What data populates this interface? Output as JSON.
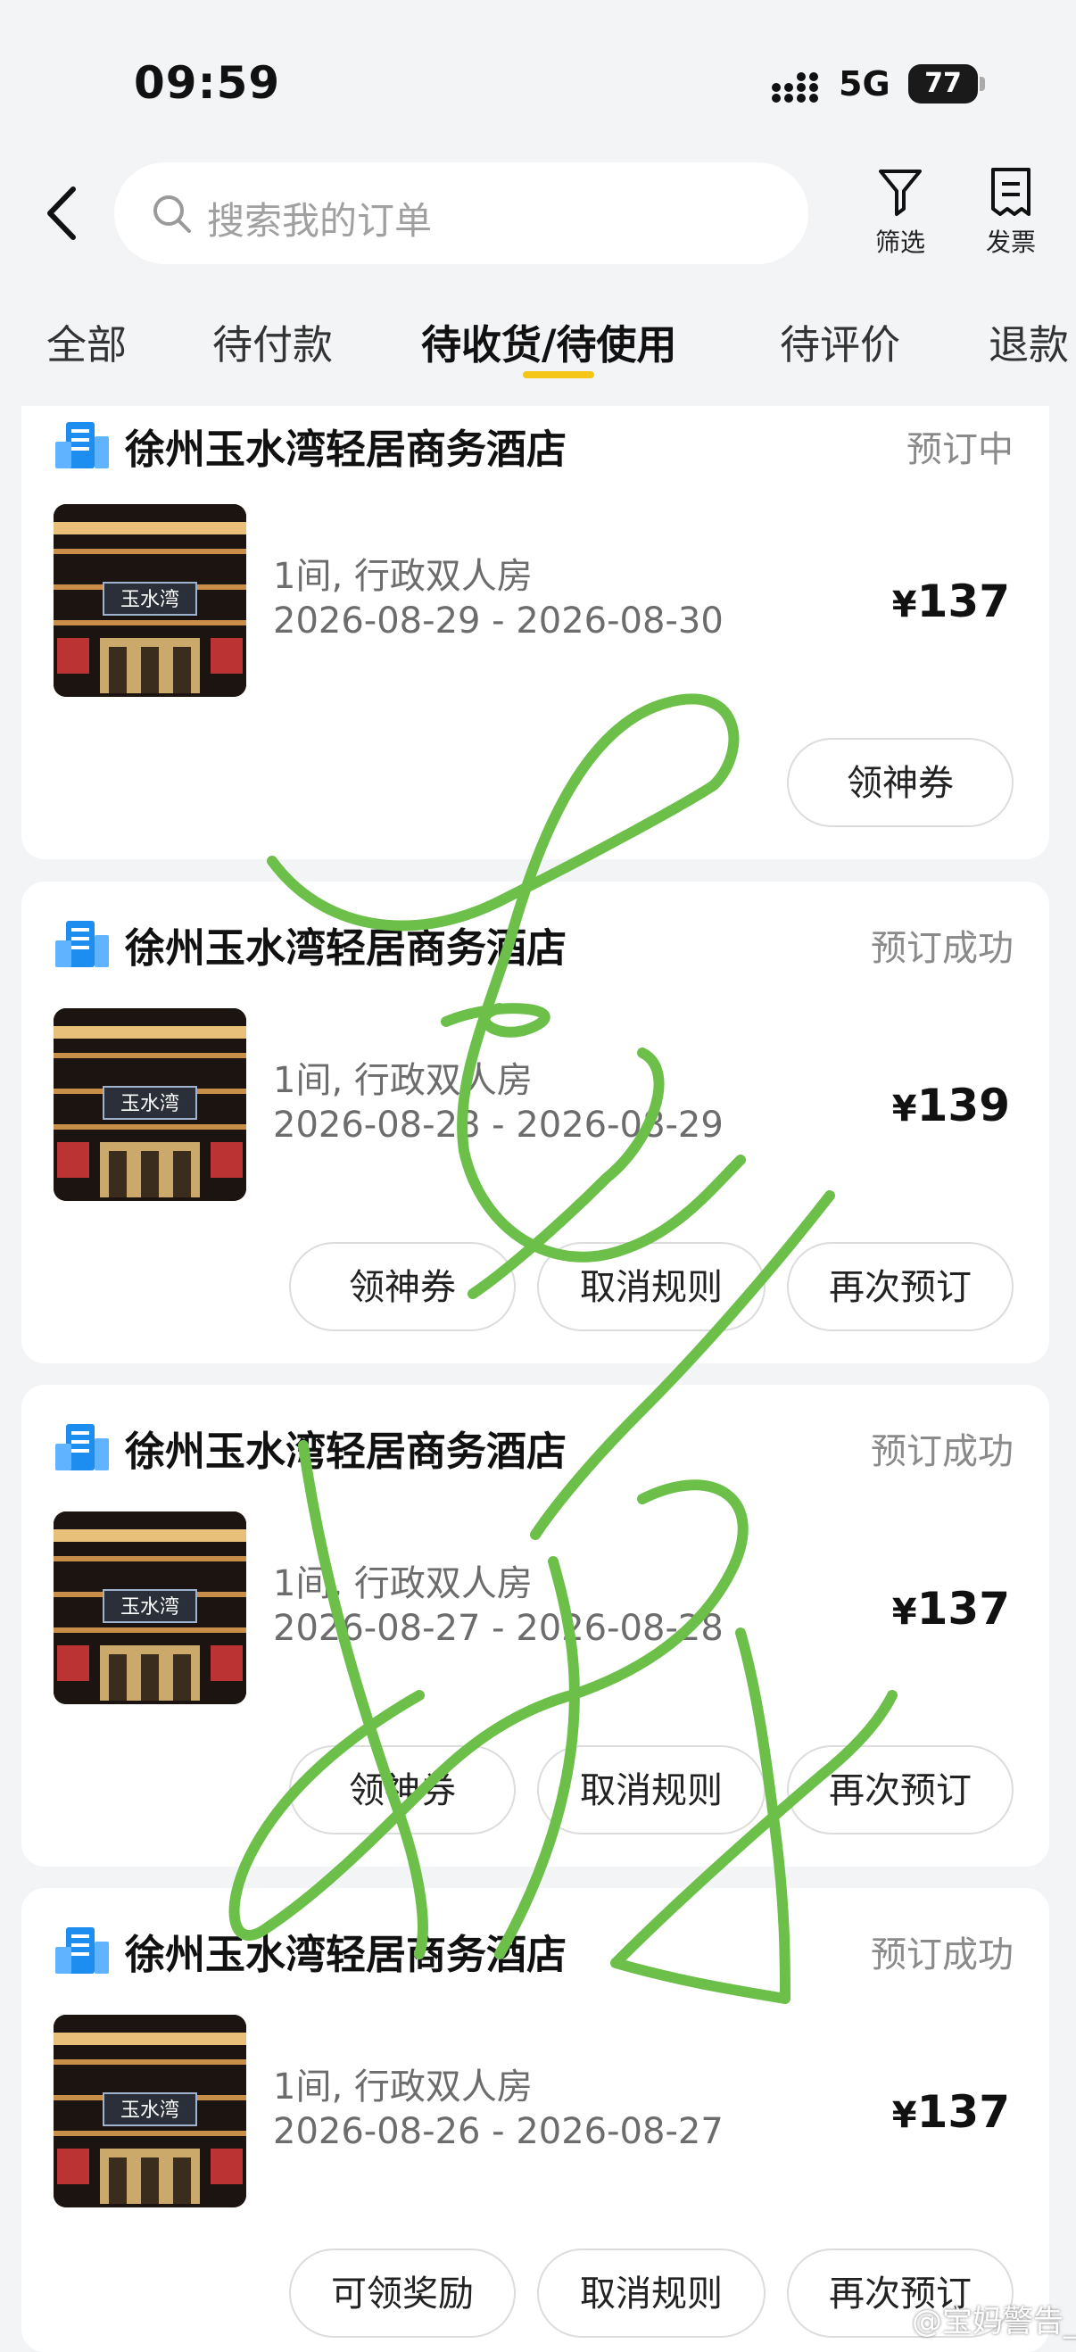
{
  "status_bar": {
    "time": "09:59",
    "network": "5G",
    "battery": "77"
  },
  "header": {
    "search_placeholder": "搜索我的订单",
    "filter_label": "筛选",
    "invoice_label": "发票"
  },
  "tabs": [
    {
      "label": "全部"
    },
    {
      "label": "待付款"
    },
    {
      "label": "待收货/待使用",
      "active": true
    },
    {
      "label": "待评价"
    },
    {
      "label": "退款"
    }
  ],
  "orders": [
    {
      "hotel": "徐州玉水湾轻居商务酒店",
      "status": "预订中",
      "room": "1间, 行政双人房",
      "dates": "2026-08-29 - 2026-08-30",
      "currency": "¥",
      "price": "137",
      "buttons": [
        "领神券"
      ]
    },
    {
      "hotel": "徐州玉水湾轻居商务酒店",
      "status": "预订成功",
      "room": "1间, 行政双人房",
      "dates": "2026-08-28 - 2026-08-29",
      "currency": "¥",
      "price": "139",
      "buttons": [
        "领神券",
        "取消规则",
        "再次预订"
      ]
    },
    {
      "hotel": "徐州玉水湾轻居商务酒店",
      "status": "预订成功",
      "room": "1间, 行政双人房",
      "dates": "2026-08-27 - 2026-08-28",
      "currency": "¥",
      "price": "137",
      "buttons": [
        "领神券",
        "取消规则",
        "再次预订"
      ]
    },
    {
      "hotel": "徐州玉水湾轻居商务酒店",
      "status": "预订成功",
      "room": "1间, 行政双人房",
      "dates": "2026-08-26 - 2026-08-27",
      "currency": "¥",
      "price": "137",
      "buttons": [
        "可领奖励",
        "取消规则",
        "再次预订"
      ]
    }
  ],
  "hotel_sign_text": "玉水湾",
  "watermark": "@宝妈警告_",
  "colors": {
    "accent": "#f5c518",
    "hotel_icon": "#1e8df0",
    "scribble": "#6cc04a"
  }
}
